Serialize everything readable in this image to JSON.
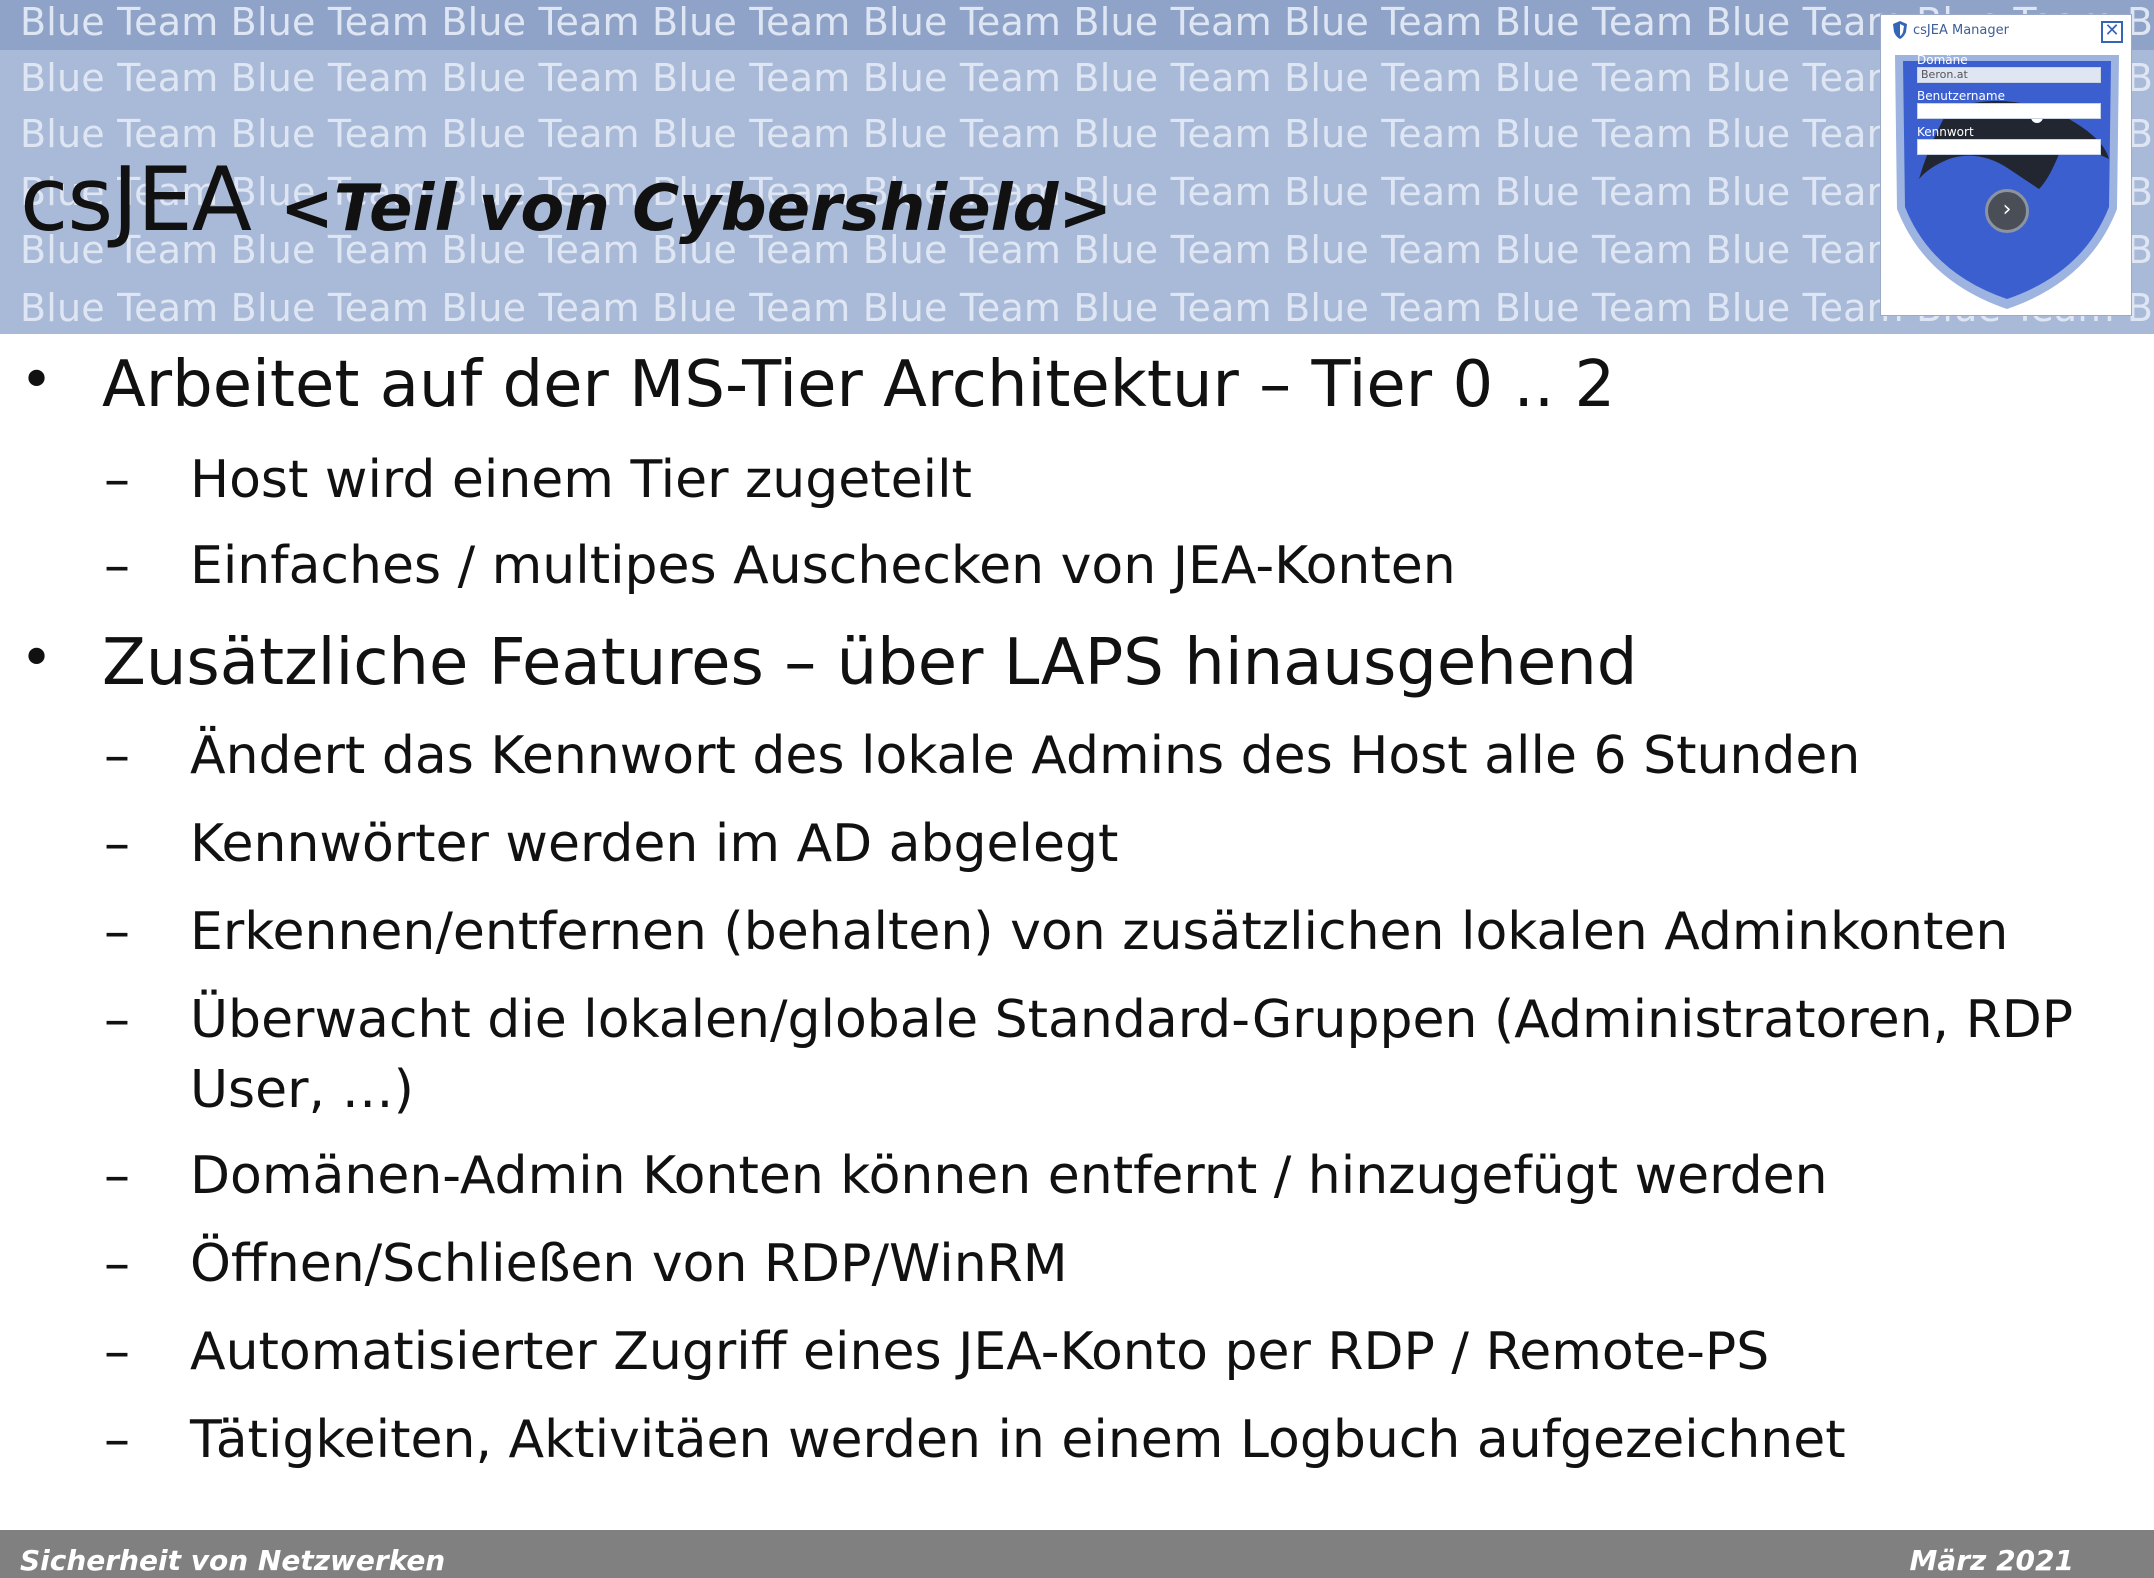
{
  "header": {
    "watermark_text": "Blue Team Blue Team Blue Team Blue Team Blue Team Blue Team Blue Team Blue Team Blue Team Blue Team Blue Team Blue Team",
    "title": "csJEA",
    "subtitle": "<Teil von Cybershield>"
  },
  "login_widget": {
    "title": "csJEA Manager",
    "domain_label": "Domäne",
    "domain_value": "Beron.at",
    "username_label": "Benutzername",
    "password_label": "Kennwort",
    "colors": {
      "shield": "#3b5fcf",
      "accent": "#3566b5"
    }
  },
  "bullets": [
    {
      "text": "Arbeitet auf der MS-Tier Architektur – Tier 0 .. 2",
      "children": [
        "Host wird einem Tier zugeteilt",
        "Einfaches / multipes Auschecken von JEA-Konten"
      ]
    },
    {
      "text": "Zusätzliche Features – über LAPS hinausgehend",
      "children": [
        "Ändert das Kennwort des lokale Admins des Host alle 6 Stunden",
        "Kennwörter werden im AD abgelegt",
        "Erkennen/entfernen (behalten) von zusätzlichen lokalen Adminkonten",
        "Überwacht die lokalen/globale Standard-Gruppen (Administratoren, RDP",
        "User, …)",
        "Domänen-Admin Konten können entfernt / hinzugefügt werden",
        "Öffnen/Schließen von RDP/WinRM",
        "Automatisierter Zugriff eines JEA-Konto per RDP / Remote-PS",
        "Tätigkeiten, Aktivitäen werden in einem Logbuch aufgezeichnet"
      ]
    }
  ],
  "markers": {
    "level1": "•",
    "level2": "–"
  },
  "footer": {
    "left": "Sicherheit von Netzwerken",
    "right": "März 2021"
  }
}
